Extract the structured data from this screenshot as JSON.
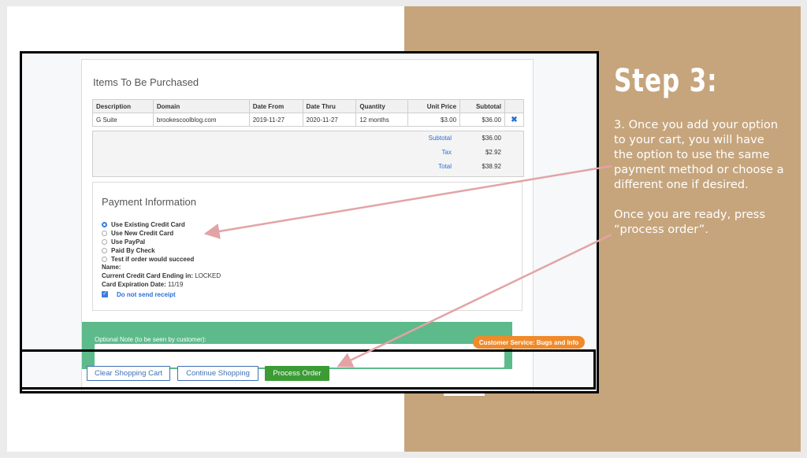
{
  "step": {
    "title": "Step 3:",
    "text1": "3. Once you add your option to your cart, you will have the option to use the same payment method or choose a different one if desired.",
    "text2": "Once you are ready, press “process order”."
  },
  "items": {
    "heading": "Items To Be Purchased",
    "columns": [
      "Description",
      "Domain",
      "Date From",
      "Date Thru",
      "Quantity",
      "Unit Price",
      "Subtotal"
    ],
    "row": {
      "description": "G Suite",
      "domain": "brookescoolblog.com",
      "date_from": "2019-11-27",
      "date_thru": "2020-11-27",
      "quantity": "12 months",
      "unit_price": "$3.00",
      "subtotal": "$36.00"
    },
    "remove_icon": "✖",
    "summary": [
      {
        "label": "Subtotal",
        "value": "$36.00"
      },
      {
        "label": "Tax",
        "value": "$2.92"
      },
      {
        "label": "Total",
        "value": "$38.92"
      }
    ]
  },
  "payment": {
    "heading": "Payment Information",
    "options": [
      {
        "label": "Use Existing Credit Card",
        "selected": true
      },
      {
        "label": "Use New Credit Card",
        "selected": false
      },
      {
        "label": "Use PayPal",
        "selected": false
      },
      {
        "label": "Paid By Check",
        "selected": false
      },
      {
        "label": "Test if order would succeed",
        "selected": false
      }
    ],
    "name_label": "Name:",
    "card_label": "Current Credit Card Ending in:",
    "card_value": "LOCKED",
    "exp_label": "Card Expiration Date:",
    "exp_value": "11/19",
    "receipt_label": "Do not send receipt",
    "receipt_checked": true
  },
  "note": {
    "label": "Optional Note (to be seen by customer):"
  },
  "customer_service": "Customer Service: Bugs and Info",
  "buttons": {
    "clear": "Clear Shopping Cart",
    "continue": "Continue Shopping",
    "process": "Process Order"
  },
  "colors": {
    "tan": "#c6a57d",
    "link_blue": "#2a6fd6",
    "green_band": "#5dba8b",
    "process_green": "#3c9b35",
    "orange": "#f08a2a",
    "arrow_pink": "#e3a3a5"
  }
}
